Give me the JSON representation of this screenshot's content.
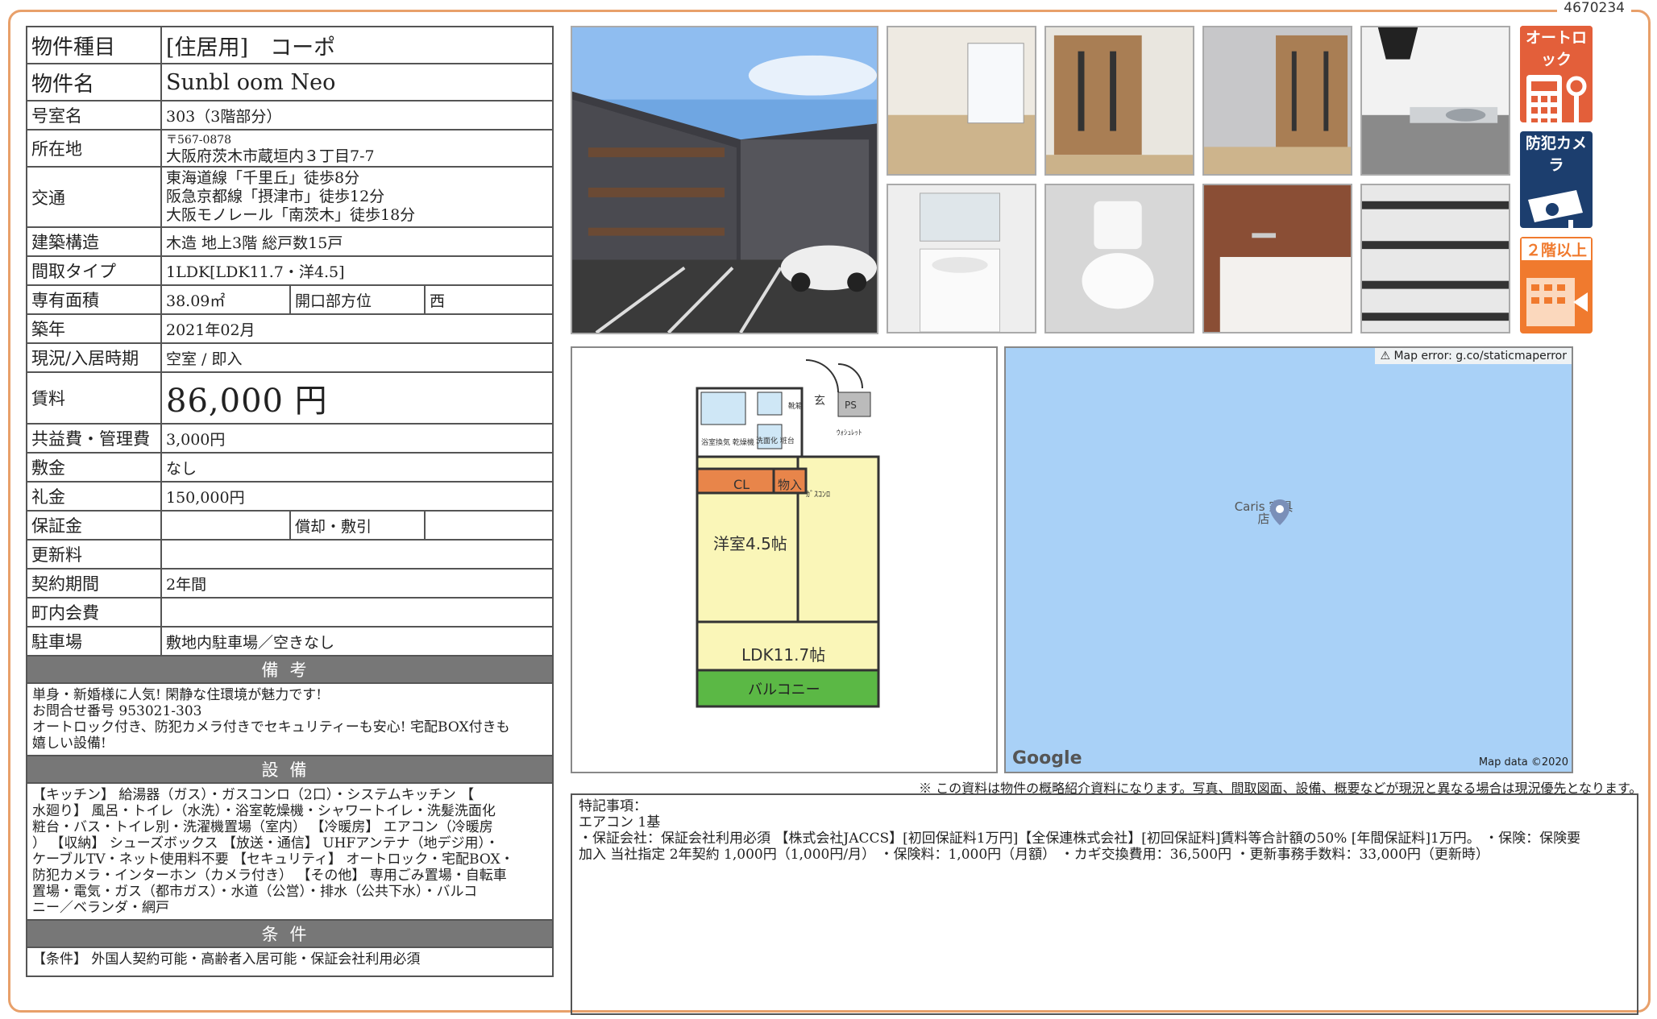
{
  "doc_id": "4670234",
  "spec": {
    "type_label": "物件種目",
    "type_value": "[住居用]　コーポ",
    "name_label": "物件名",
    "name_value": "Sunbl oom Neo",
    "room_label": "号室名",
    "room_value": "303（3階部分）",
    "address_label": "所在地",
    "postal": "〒567-0878",
    "address_value": "大阪府茨木市蔵垣内３丁目7-7",
    "access_label": "交通",
    "access_lines": [
      "東海道線「千里丘」徒歩8分",
      "阪急京都線「摂津市」徒歩12分",
      "大阪モノレール「南茨木」徒歩18分"
    ],
    "structure_label": "建築構造",
    "structure_value": "木造 地上3階 総戸数15戸",
    "layout_label": "間取タイプ",
    "layout_value": "1LDK[LDK11.7・洋4.5]",
    "area_label": "専有面積",
    "area_value": "38.09㎡",
    "direction_label": "開口部方位",
    "direction_value": "西",
    "built_label": "築年",
    "built_value": "2021年02月",
    "status_label": "現況/入居時期",
    "status_value": "空室 / 即入",
    "rent_label": "賃料",
    "rent_value": "86,000 円",
    "fee_label": "共益費・管理費",
    "fee_value": "3,000円",
    "deposit_label": "敷金",
    "deposit_value": "なし",
    "key_money_label": "礼金",
    "key_money_value": "150,000円",
    "guarantee_label": "保証金",
    "guarantee_value": "",
    "amort_label": "償却・敷引",
    "amort_value": "",
    "renewal_label": "更新料",
    "renewal_value": "",
    "contract_label": "契約期間",
    "contract_value": "2年間",
    "assoc_label": "町内会費",
    "assoc_value": "",
    "parking_label": "駐車場",
    "parking_value": "敷地内駐車場／空きなし"
  },
  "remarks": {
    "title": "備考",
    "lines": [
      "単身・新婚様に人気! 閑静な住環境が魅力です!",
      "お問合せ番号 953021-303",
      "オートロック付き、防犯カメラ付きでセキュリティーも安心! 宅配BOX付きも",
      "嬉しい設備!"
    ]
  },
  "facilities": {
    "title": "設備",
    "lines": [
      "【キッチン】 給湯器（ガス）・ガスコンロ（2口）・システムキッチン 【",
      "水廻り】 風呂・トイレ（水洗）・浴室乾燥機・シャワートイレ・洗髪洗面化",
      "粧台・バス・トイレ別・洗濯機置場（室内） 【冷暖房】 エアコン（冷暖房",
      "） 【収納】 シューズボックス 【放送・通信】 UHFアンテナ（地デジ用）・",
      "ケーブルTV・ネット使用料不要 【セキュリティ】 オートロック・宅配BOX・",
      "防犯カメラ・インターホン（カメラ付き） 【その他】 専用ごみ置場・自転車",
      "置場・電気・ガス（都市ガス）・水道（公営）・排水（公共下水）・バルコ",
      "ニー／ベランダ・網戸"
    ]
  },
  "conditions": {
    "title": "条件",
    "text": "【条件】 外国人契約可能・高齢者入居可能・保証会社利用必須"
  },
  "badges": {
    "autolock": "オートロック",
    "camera": "防犯カメラ",
    "floor2": "２階以上"
  },
  "floorplan": {
    "western_room": "洋室4.5帖",
    "ldk": "LDK11.7帖",
    "balcony": "バルコニー",
    "cl": "CL",
    "storage": "物入",
    "entrance": "玄",
    "ps": "PS",
    "shoe": "靴箱",
    "bath": "浴室換気 乾燥機",
    "wash": "洗面化 粧台",
    "toilet": "ｳｫｼｭﾚｯﾄ",
    "stove": "ｶﾞｽｺﾝﾛ"
  },
  "map": {
    "error": "⚠ Map error: g.co/staticmaperror",
    "place": "Caris 家具店",
    "google": "Google",
    "data": "Map data ©2020"
  },
  "disclaimer": "※ この資料は物件の概略紹介資料になります。写真、間取図面、設備、概要などが現況と異なる場合は現況優先となります。",
  "notes": {
    "lines": [
      "特記事項：",
      "エアコン 1基",
      "・保証会社：保証会社利用必須 【株式会社JACCS】[初回保証料1万円]【全保連株式会社】[初回保証料]賃料等合計額の50% [年間保証料]1万円。 ・保険：保険要",
      "加入 当社指定 2年契約 1,000円（1,000円/月） ・保険料：1,000円（月額） ・カギ交換費用：36,500円 ・更新事務手数料：33,000円（更新時）"
    ]
  }
}
